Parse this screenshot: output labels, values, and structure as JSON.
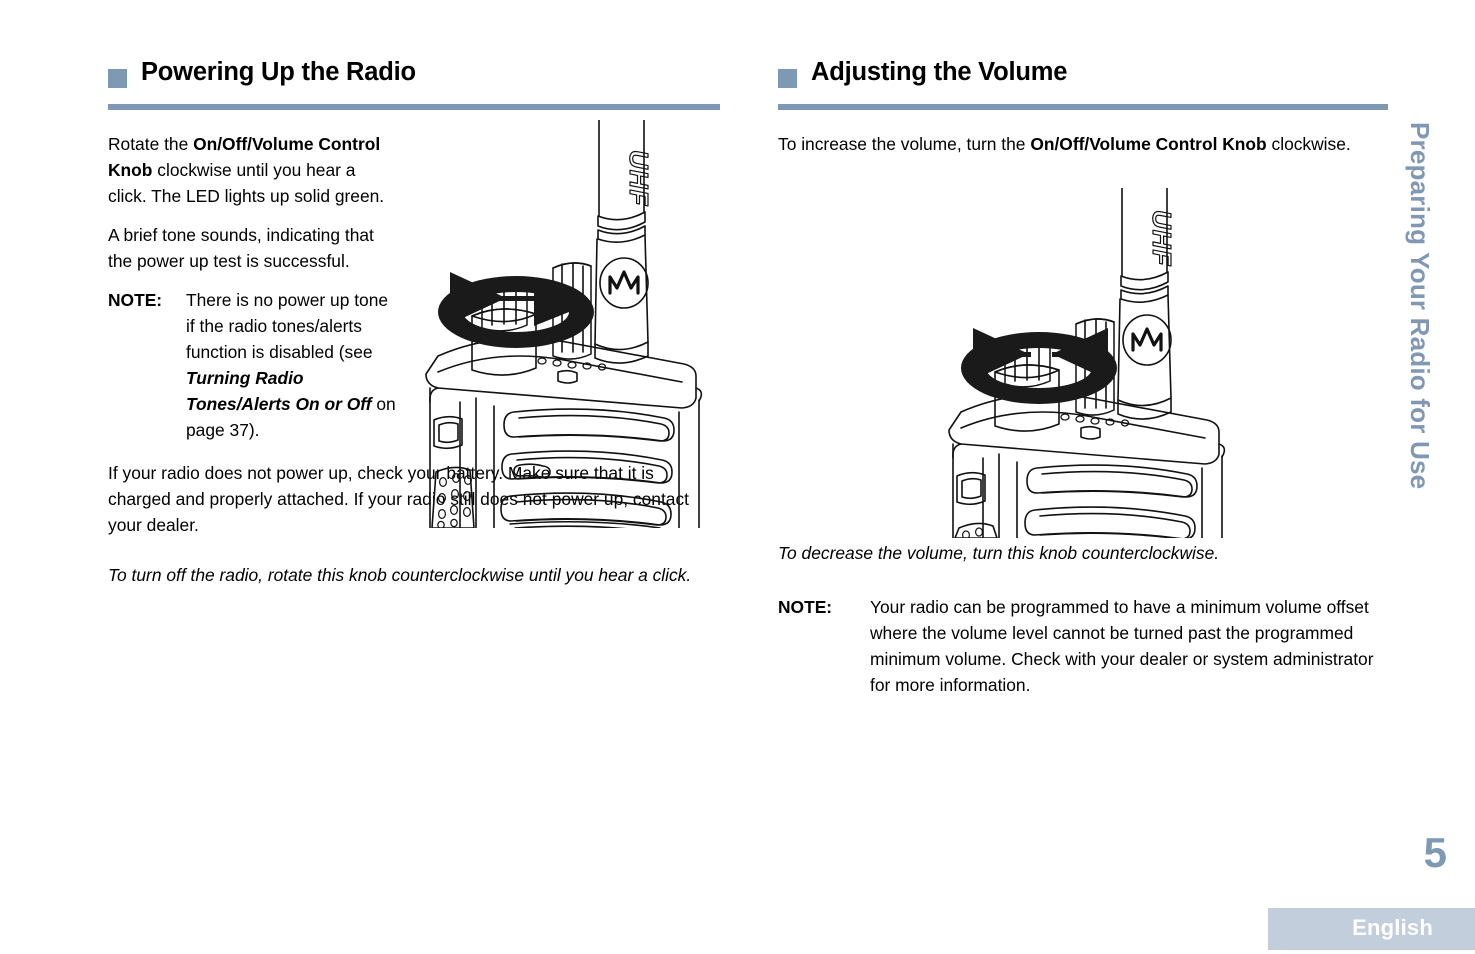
{
  "page": {
    "number": "5",
    "language": "English",
    "running_head": "Preparing Your Radio for Use",
    "accent_color": "#7e99b4",
    "running_head_color": "#8098b4",
    "language_band_color": "#c3cedc"
  },
  "left_column": {
    "heading": "Powering Up the Radio",
    "paragraph_1": {
      "part_1": "Rotate the ",
      "bold_1": "On/Off/Volume Control Knob",
      "part_2": " clockwise until you hear a click. The LED lights up solid green."
    },
    "paragraph_2": "A brief tone sounds, indicating that the power up test is successful.",
    "note": {
      "label": "NOTE:",
      "part_1": "There is no power up tone if the radio tones/alerts function is disabled (see ",
      "bold_italic": "Turning Radio Tones/Alerts On or Off",
      "part_2": " on page 37)."
    },
    "paragraph_3": "If your radio does not power up, check your battery. Make sure that it is charged and properly attached. If your radio still does not power up, contact your dealer.",
    "paragraph_4_italic": "To turn off the radio, rotate this knob counterclockwise until you hear a click.",
    "figure": {
      "alt": "Two-way radio with clockwise rotation arrow around the volume knob",
      "antenna_label": "UHF",
      "brand_mark": "motorola-m-logo"
    }
  },
  "right_column": {
    "heading": "Adjusting the Volume",
    "paragraph_1": {
      "part_1": "To increase the volume, turn the ",
      "bold_1": "On/Off/Volume Control Knob",
      "part_2": " clockwise."
    },
    "paragraph_2_italic": "To decrease the volume, turn this knob counterclockwise.",
    "note": {
      "label": "NOTE:",
      "text": "Your radio can be programmed to have a minimum volume offset where the volume level cannot be turned past the programmed minimum volume. Check with your dealer or system administrator for more information."
    },
    "figure": {
      "alt": "Two-way radio with bidirectional rotation arrows around the volume knob",
      "antenna_label": "UHF",
      "brand_mark": "motorola-m-logo"
    }
  }
}
